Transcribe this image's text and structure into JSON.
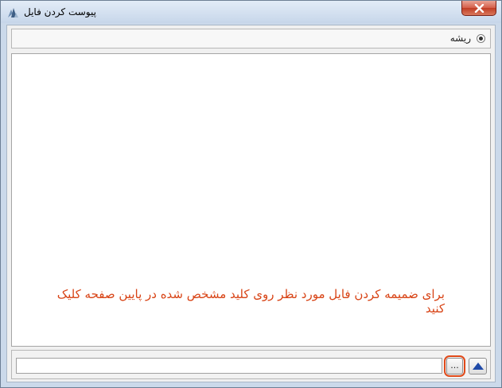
{
  "window": {
    "title": "پیوست کردن فایل",
    "close_icon": "close-icon"
  },
  "radio": {
    "label": "ریشه",
    "selected": true
  },
  "content": {
    "instruction": "برای ضمیمه کردن فایل مورد نظر روی کلید مشخص شده در پایین صفحه کلیک کنید"
  },
  "bottom": {
    "path_value": "",
    "browse_label": "...",
    "upload_icon": "arrow-up-icon"
  },
  "colors": {
    "instruction": "#d84315",
    "highlight": "#e04a1a"
  }
}
